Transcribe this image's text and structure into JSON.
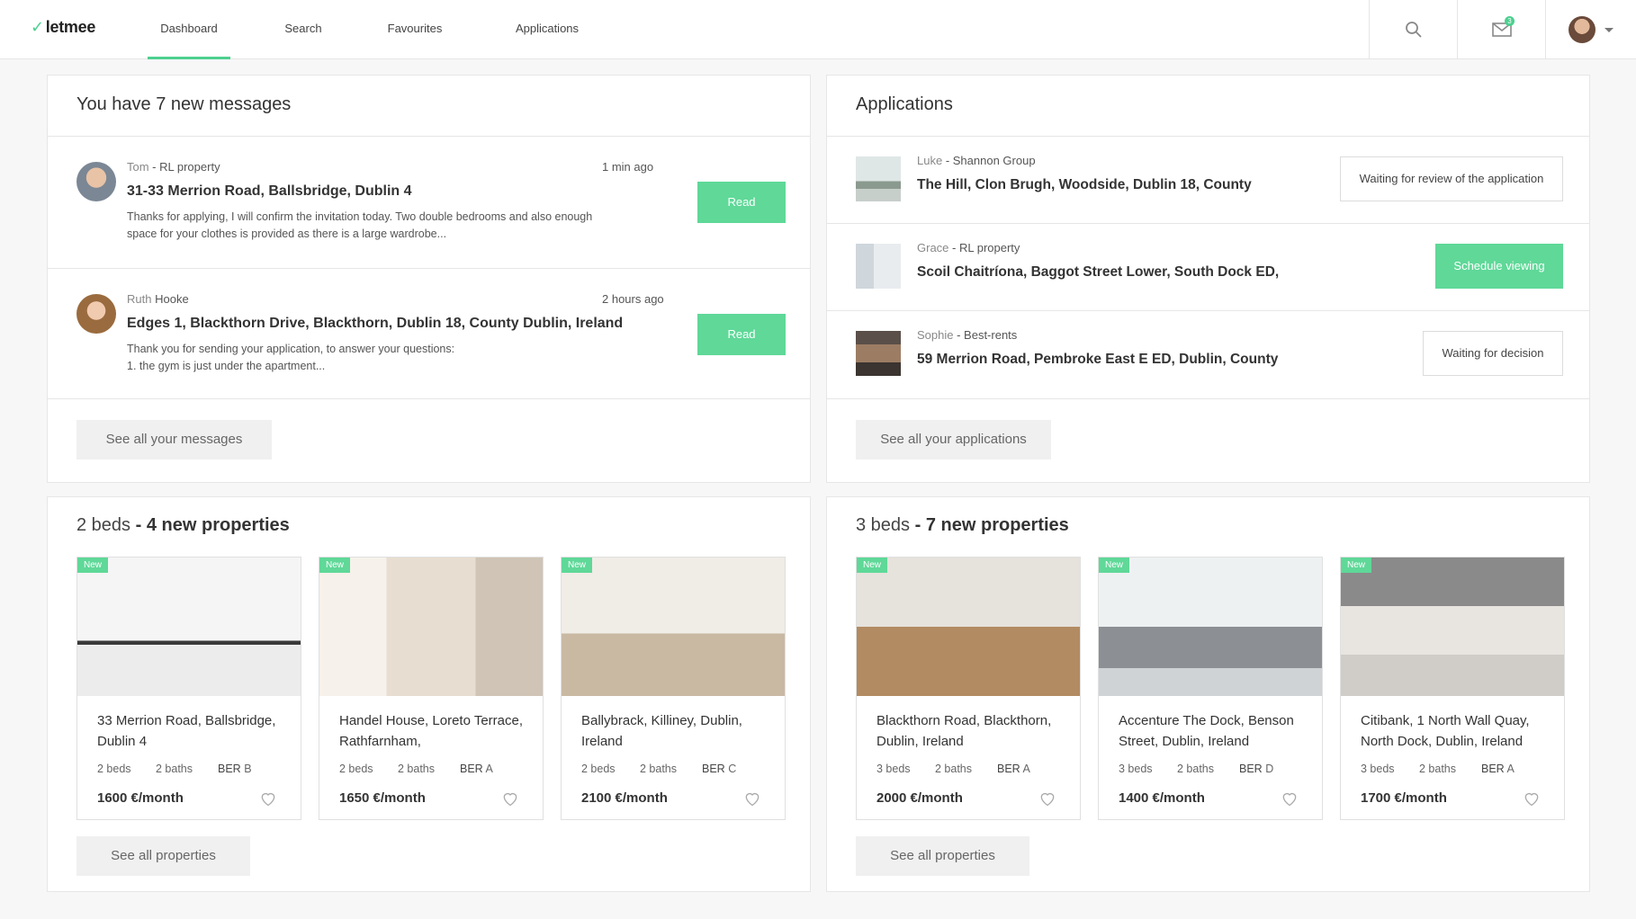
{
  "nav": {
    "logo": "letmee",
    "tabs": [
      {
        "label": "Dashboard",
        "active": true
      },
      {
        "label": "Search"
      },
      {
        "label": "Favourites"
      },
      {
        "label": "Applications"
      }
    ],
    "mail_badge": "3",
    "icons": [
      "search-icon",
      "mail-icon",
      "avatar",
      "chevron-down-icon"
    ]
  },
  "messages": {
    "title": "You have 7 new messages",
    "items": [
      {
        "sender_name": "Tom",
        "sender_company": "RL property",
        "time": "1 min ago",
        "title": "31-33 Merrion Road, Ballsbridge, Dublin 4",
        "body": "Thanks for applying, I will confirm the invitation today. Two double bedrooms and also enough space for your clothes is provided as there is a large wardrobe...",
        "button": "Read"
      },
      {
        "sender_name": "Ruth",
        "sender_company": "Hooke",
        "time": "2 hours ago",
        "title": "Edges 1, Blackthorn Drive, Blackthorn, Dublin 18, County Dublin, Ireland",
        "body": "Thank you for sending your application, to answer your questions:\n1. the gym is just under the apartment...",
        "button": "Read"
      }
    ],
    "see_all": "See all your messages"
  },
  "applications": {
    "title": "Applications",
    "items": [
      {
        "sender_name": "Luke",
        "sender_company": "Shannon Group",
        "title": "The Hill, Clon Brugh, Woodside, Dublin 18, County",
        "status": "Waiting for review of the application"
      },
      {
        "sender_name": "Grace",
        "sender_company": "RL property",
        "title": "Scoil Chaitríona, Baggot Street Lower, South Dock ED,",
        "status": "Schedule viewing"
      },
      {
        "sender_name": "Sophie",
        "sender_company": "Best-rents",
        "title": "59 Merrion Road, Pembroke East E ED, Dublin, County",
        "status": "Waiting for decision"
      }
    ],
    "see_all": "See all your applications"
  },
  "beds2": {
    "title_prefix": "2 beds",
    "title_suffix": "- 4 new properties",
    "cards": [
      {
        "tag": "New",
        "title": "33 Merrion Road, Ballsbridge, Dublin 4",
        "beds": "2 beds",
        "baths": "2 baths",
        "ber_label": "BER",
        "ber": "B",
        "price": "1600 €/month"
      },
      {
        "tag": "New",
        "title": "Handel House, Loreto Terrace, Rathfarnham,",
        "beds": "2 beds",
        "baths": "2 baths",
        "ber_label": "BER",
        "ber": "A",
        "price": "1650 €/month"
      },
      {
        "tag": "New",
        "title": "Ballybrack, Killiney, Dublin, Ireland",
        "beds": "2 beds",
        "baths": "2 baths",
        "ber_label": "BER",
        "ber": "C",
        "price": "2100 €/month"
      }
    ],
    "see_all": "See all properties"
  },
  "beds3": {
    "title_prefix": "3 beds",
    "title_suffix": "- 7 new properties",
    "cards": [
      {
        "tag": "New",
        "title": "Blackthorn Road, Blackthorn, Dublin, Ireland",
        "beds": "3 beds",
        "baths": "2 baths",
        "ber_label": "BER",
        "ber": "A",
        "price": "2000 €/month"
      },
      {
        "tag": "New",
        "title": "Accenture The Dock, Benson Street, Dublin, Ireland",
        "beds": "3 beds",
        "baths": "2 baths",
        "ber_label": "BER",
        "ber": "D",
        "price": "1400 €/month"
      },
      {
        "tag": "New",
        "title": "Citibank, 1 North Wall Quay, North Dock, Dublin, Ireland",
        "beds": "3 beds",
        "baths": "2 baths",
        "ber_label": "BER",
        "ber": "A",
        "price": "1700 €/month"
      }
    ],
    "see_all": "See all properties"
  },
  "colors": {
    "accent": "#5fd898",
    "border": "#e6e6e6",
    "background": "#f7f7f7"
  }
}
